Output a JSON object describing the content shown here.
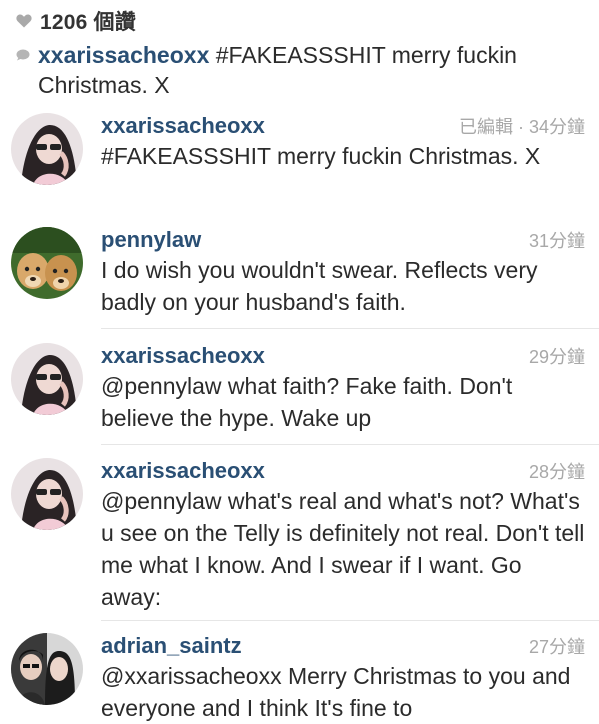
{
  "likes": {
    "icon": "heart-icon",
    "text": "1206 個讚"
  },
  "caption": {
    "icon": "comment-bubble-icon",
    "user": "xxarissacheoxx",
    "text": " #FAKEASSSHIT merry fuckin Christmas. X"
  },
  "comments": [
    {
      "user": "xxarissacheoxx",
      "time": "已編輯 · 34分鐘",
      "text": "#FAKEASSSHIT merry fuckin Christmas. X"
    },
    {
      "user": "pennylaw",
      "time": "31分鐘",
      "text": "I do wish you wouldn't swear. Reflects very badly on your husband's faith."
    },
    {
      "user": "xxarissacheoxx",
      "time": "29分鐘",
      "text": "@pennylaw what faith? Fake faith. Don't believe the hype. Wake up"
    },
    {
      "user": "xxarissacheoxx",
      "time": "28分鐘",
      "text": "@pennylaw what's real and what's not? What's u see on the Telly is definitely not real. Don't tell me what I know. And I swear if I want. Go away:"
    },
    {
      "user": "adrian_saintz",
      "time": "27分鐘",
      "text": "@xxarissacheoxx Merry Christmas to you and everyone and I think It's fine to"
    }
  ],
  "colors": {
    "username": "#2a4f74",
    "timestamp": "#a8a8a8",
    "text": "#2b2b2b"
  }
}
